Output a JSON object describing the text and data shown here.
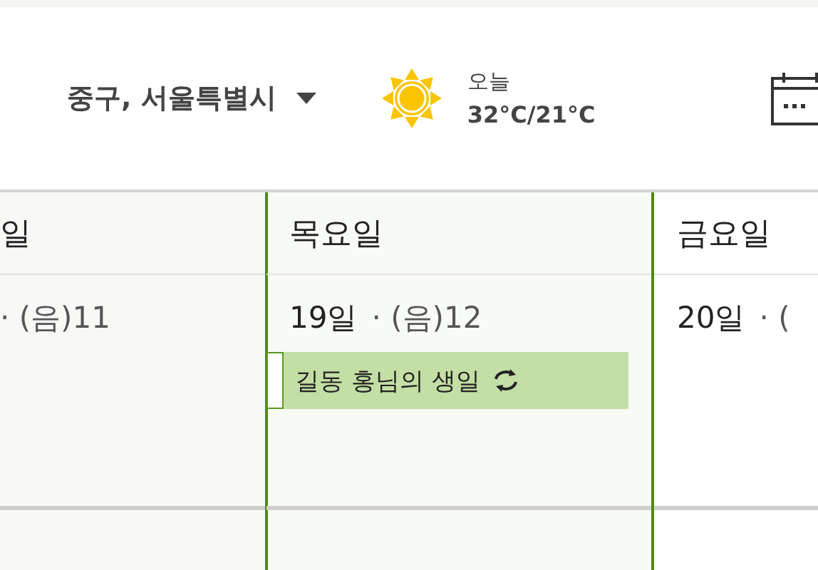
{
  "location": {
    "label": "중구, 서울특별시"
  },
  "weather": {
    "day": "오늘",
    "temps": "32°C/21°C"
  },
  "days": [
    {
      "heading": "일",
      "lunar": "· (음)11",
      "selected": false
    },
    {
      "heading": "목요일",
      "date": "19일",
      "lunar": "· (음)12",
      "selected": true,
      "events": [
        {
          "title": "길동 홍님의 생일",
          "recurring": true
        }
      ]
    },
    {
      "heading": "금요일",
      "date": "20일",
      "lunar": "· (",
      "selected": false
    }
  ]
}
